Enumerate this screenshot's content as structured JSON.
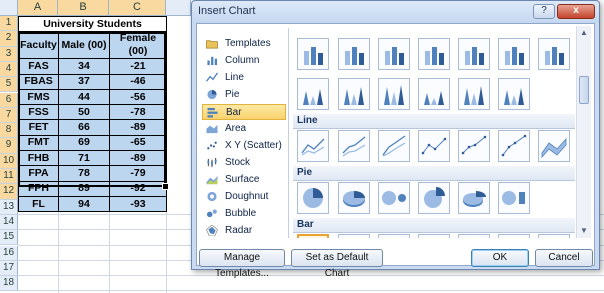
{
  "spreadsheet": {
    "columns": [
      "A",
      "B",
      "C"
    ],
    "rows": [
      "1",
      "2",
      "3",
      "4",
      "5",
      "6",
      "7",
      "8",
      "9",
      "10",
      "11",
      "12",
      "13",
      "14",
      "15",
      "16",
      "17",
      "18"
    ],
    "title": "University Students",
    "headers": [
      "Faculty",
      "Male (00)",
      "Female (00)"
    ],
    "data": [
      [
        "FAS",
        "34",
        "-21"
      ],
      [
        "FBAS",
        "37",
        "-46"
      ],
      [
        "FMS",
        "44",
        "-56"
      ],
      [
        "FSS",
        "50",
        "-78"
      ],
      [
        "FET",
        "66",
        "-89"
      ],
      [
        "FMT",
        "69",
        "-65"
      ],
      [
        "FHB",
        "71",
        "-89"
      ],
      [
        "FPA",
        "78",
        "-79"
      ],
      [
        "FPH",
        "89",
        "-92"
      ],
      [
        "FL",
        "94",
        "-93"
      ]
    ]
  },
  "dialog": {
    "title": "Insert Chart",
    "help_label": "?",
    "close_label": "x",
    "categories": [
      {
        "label": "Templates",
        "icon": "folder-icon"
      },
      {
        "label": "Column",
        "icon": "column-chart-icon"
      },
      {
        "label": "Line",
        "icon": "line-chart-icon"
      },
      {
        "label": "Pie",
        "icon": "pie-chart-icon"
      },
      {
        "label": "Bar",
        "icon": "bar-chart-icon",
        "selected": true
      },
      {
        "label": "Area",
        "icon": "area-chart-icon"
      },
      {
        "label": "X Y (Scatter)",
        "icon": "scatter-chart-icon"
      },
      {
        "label": "Stock",
        "icon": "stock-chart-icon"
      },
      {
        "label": "Surface",
        "icon": "surface-chart-icon"
      },
      {
        "label": "Doughnut",
        "icon": "doughnut-chart-icon"
      },
      {
        "label": "Bubble",
        "icon": "bubble-chart-icon"
      },
      {
        "label": "Radar",
        "icon": "radar-chart-icon"
      }
    ],
    "sections": {
      "line": "Line",
      "pie": "Pie",
      "bar": "Bar"
    },
    "buttons": {
      "manage_templates": "Manage Templates...",
      "set_default": "Set as Default Chart",
      "ok": "OK",
      "cancel": "Cancel"
    },
    "colors": {
      "accent_blue": "#4f81bd",
      "selection_orange": "#e8a336"
    }
  }
}
